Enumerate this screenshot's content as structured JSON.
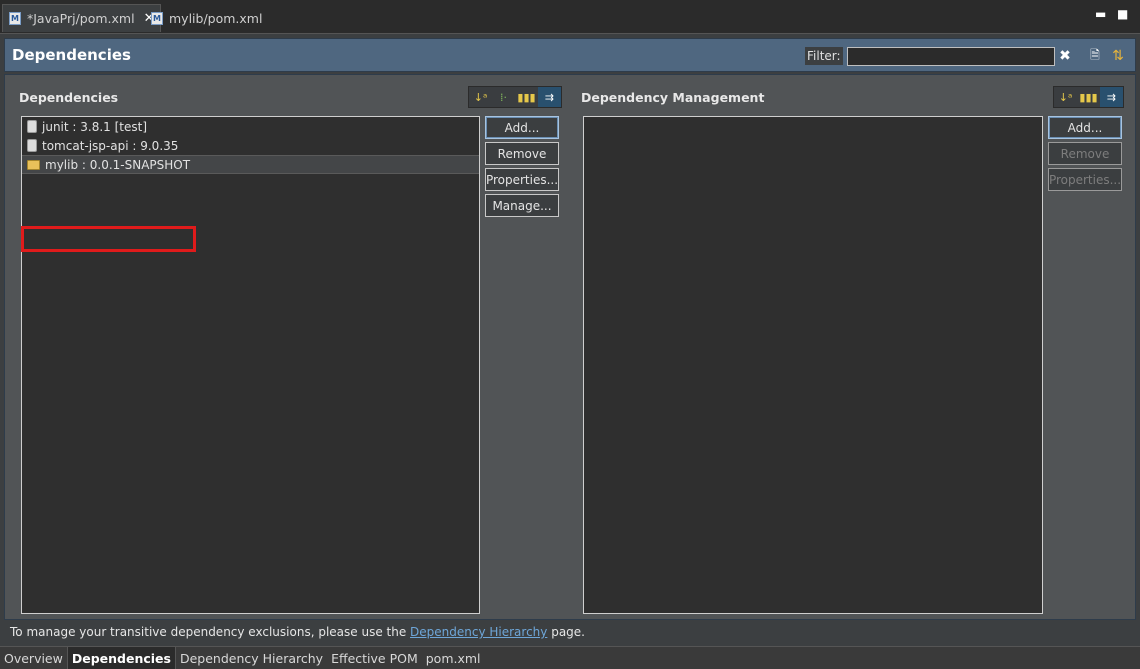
{
  "editor_tabs": [
    {
      "label": "*JavaPrj/pom.xml",
      "icon": "maven-pom-icon"
    },
    {
      "label": "mylib/pom.xml",
      "icon": "maven-pom-icon"
    }
  ],
  "header": {
    "title": "Dependencies",
    "filter_label": "Filter:",
    "filter_value": ""
  },
  "dependencies": {
    "title": "Dependencies",
    "items": [
      {
        "label": "junit : 3.8.1 [test]",
        "icon": "jar-icon"
      },
      {
        "label": "tomcat-jsp-api : 9.0.35",
        "icon": "jar-icon"
      },
      {
        "label": "mylib : 0.0.1-SNAPSHOT",
        "icon": "project-folder-icon"
      }
    ],
    "buttons": {
      "add": "Add...",
      "remove": "Remove",
      "properties": "Properties...",
      "manage": "Manage..."
    }
  },
  "dependency_management": {
    "title": "Dependency Management",
    "items": [],
    "buttons": {
      "add": "Add...",
      "remove": "Remove",
      "properties": "Properties..."
    }
  },
  "info": {
    "prefix": "To manage your transitive dependency exclusions, please use the ",
    "link": "Dependency Hierarchy",
    "suffix": " page."
  },
  "bottom_tabs": [
    "Overview",
    "Dependencies",
    "Dependency Hierarchy",
    "Effective POM",
    "pom.xml"
  ],
  "colors": {
    "highlight": "#e01b1b",
    "header_bg": "#4f6780",
    "link": "#6ea6d8"
  }
}
